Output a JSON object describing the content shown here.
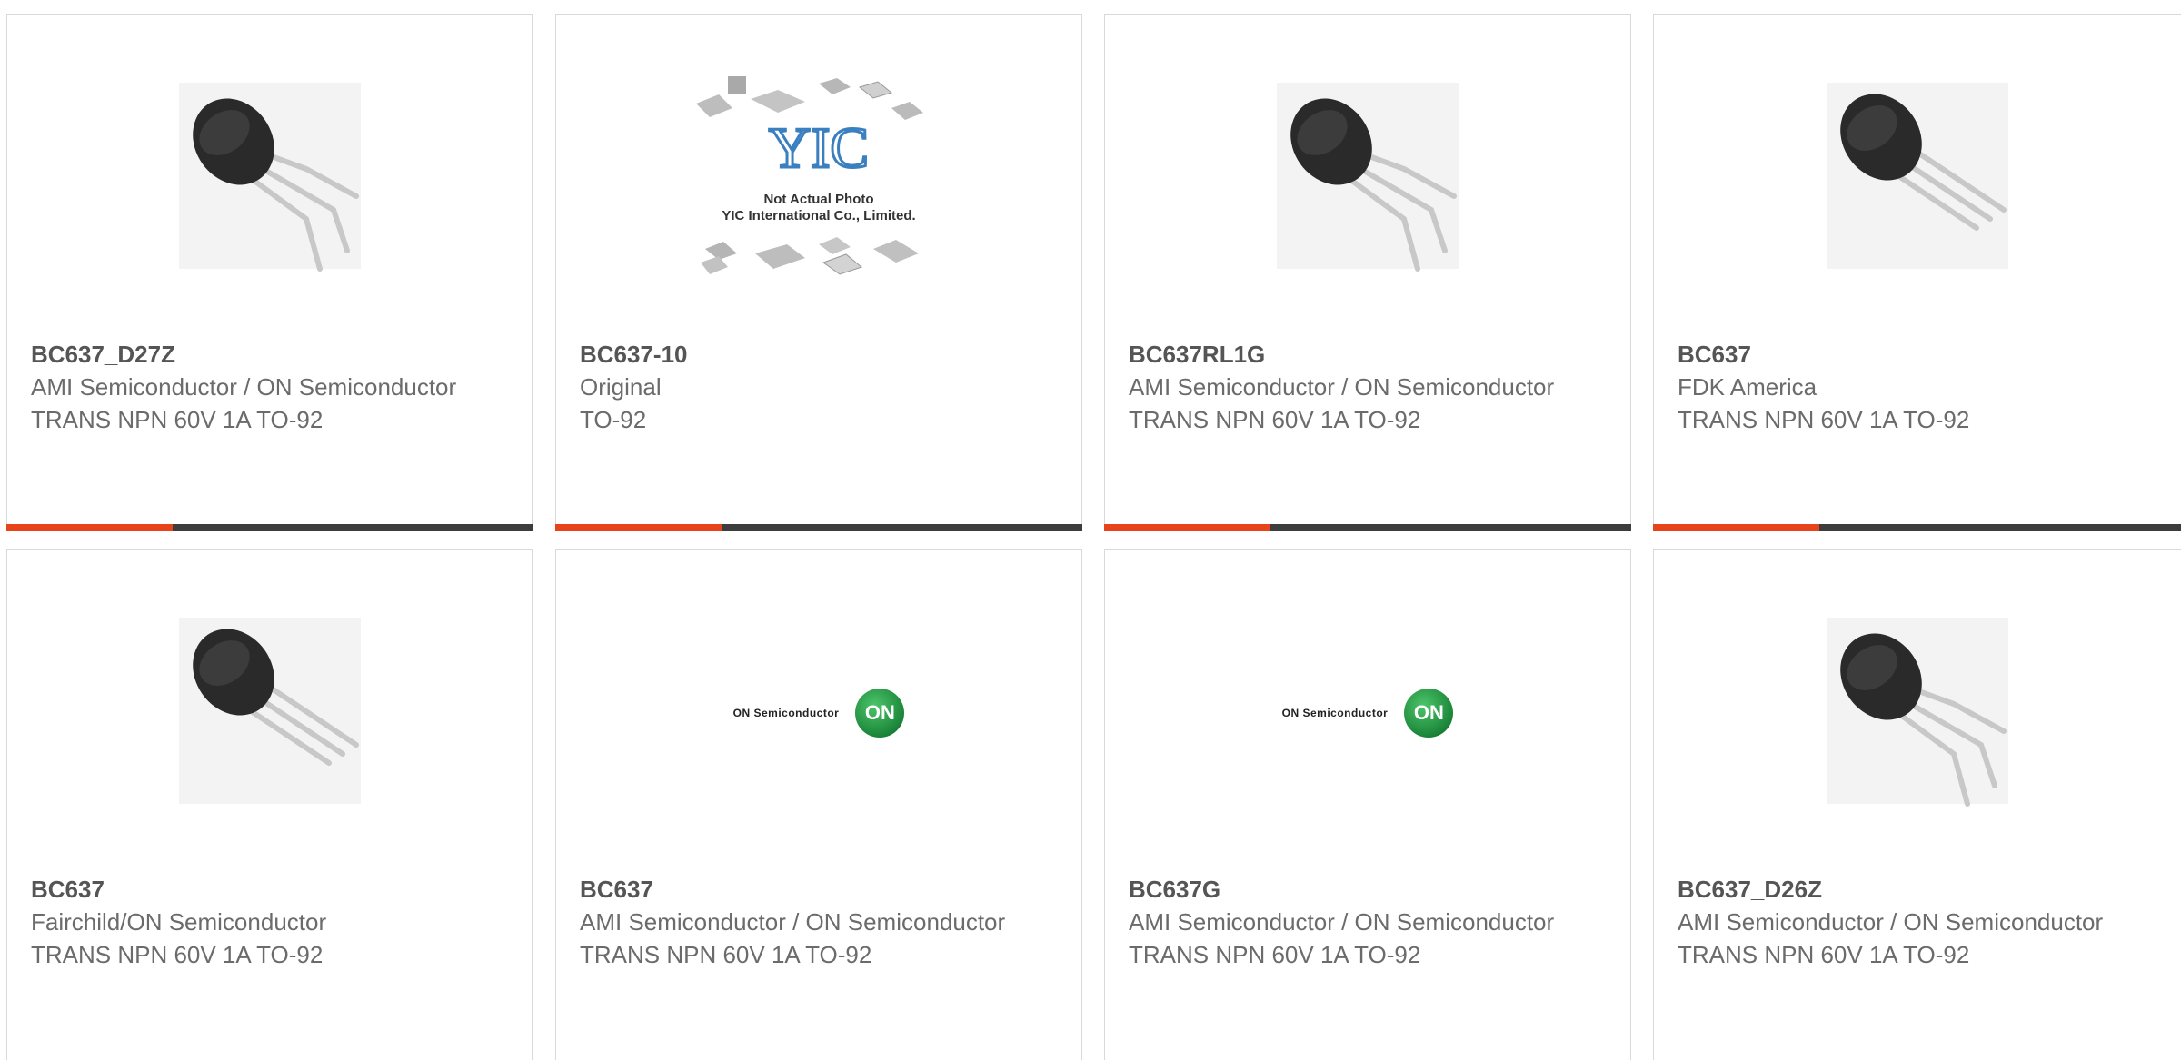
{
  "products": [
    {
      "part": "BC637_D27Z",
      "manufacturer": "AMI Semiconductor / ON Semiconductor",
      "description": "TRANS NPN 60V 1A TO-92",
      "image": "transistor-bent-leads-icon"
    },
    {
      "part": "BC637-10",
      "manufacturer": "Original",
      "description": "TO-92",
      "image": "placeholder-chips-icon",
      "placeholder_logo": "YIC",
      "placeholder_line1": "Not Actual Photo",
      "placeholder_line2": "YIC International Co., Limited."
    },
    {
      "part": "BC637RL1G",
      "manufacturer": "AMI Semiconductor / ON Semiconductor",
      "description": "TRANS NPN 60V 1A TO-92",
      "image": "transistor-bent-leads-icon"
    },
    {
      "part": "BC637",
      "manufacturer": "FDK America",
      "description": "TRANS NPN 60V 1A TO-92",
      "image": "transistor-straight-leads-icon"
    },
    {
      "part": "BC637",
      "manufacturer": "Fairchild/ON Semiconductor",
      "description": "TRANS NPN 60V 1A TO-92",
      "image": "transistor-straight-leads-icon"
    },
    {
      "part": "BC637",
      "manufacturer": "AMI Semiconductor / ON Semiconductor",
      "description": "TRANS NPN 60V 1A TO-92",
      "image": "on-semiconductor-logo",
      "logo_text": "ON Semiconductor",
      "logo_badge": "ON"
    },
    {
      "part": "BC637G",
      "manufacturer": "AMI Semiconductor / ON Semiconductor",
      "description": "TRANS NPN 60V 1A TO-92",
      "image": "on-semiconductor-logo",
      "logo_text": "ON Semiconductor",
      "logo_badge": "ON"
    },
    {
      "part": "BC637_D26Z",
      "manufacturer": "AMI Semiconductor / ON Semiconductor",
      "description": "TRANS NPN 60V 1A TO-92",
      "image": "transistor-bent-leads-icon"
    }
  ],
  "colors": {
    "accent": "#e8441b",
    "bar": "#3d3d3d",
    "border": "#d9d9d9",
    "on_green": "#1e8a3c"
  }
}
